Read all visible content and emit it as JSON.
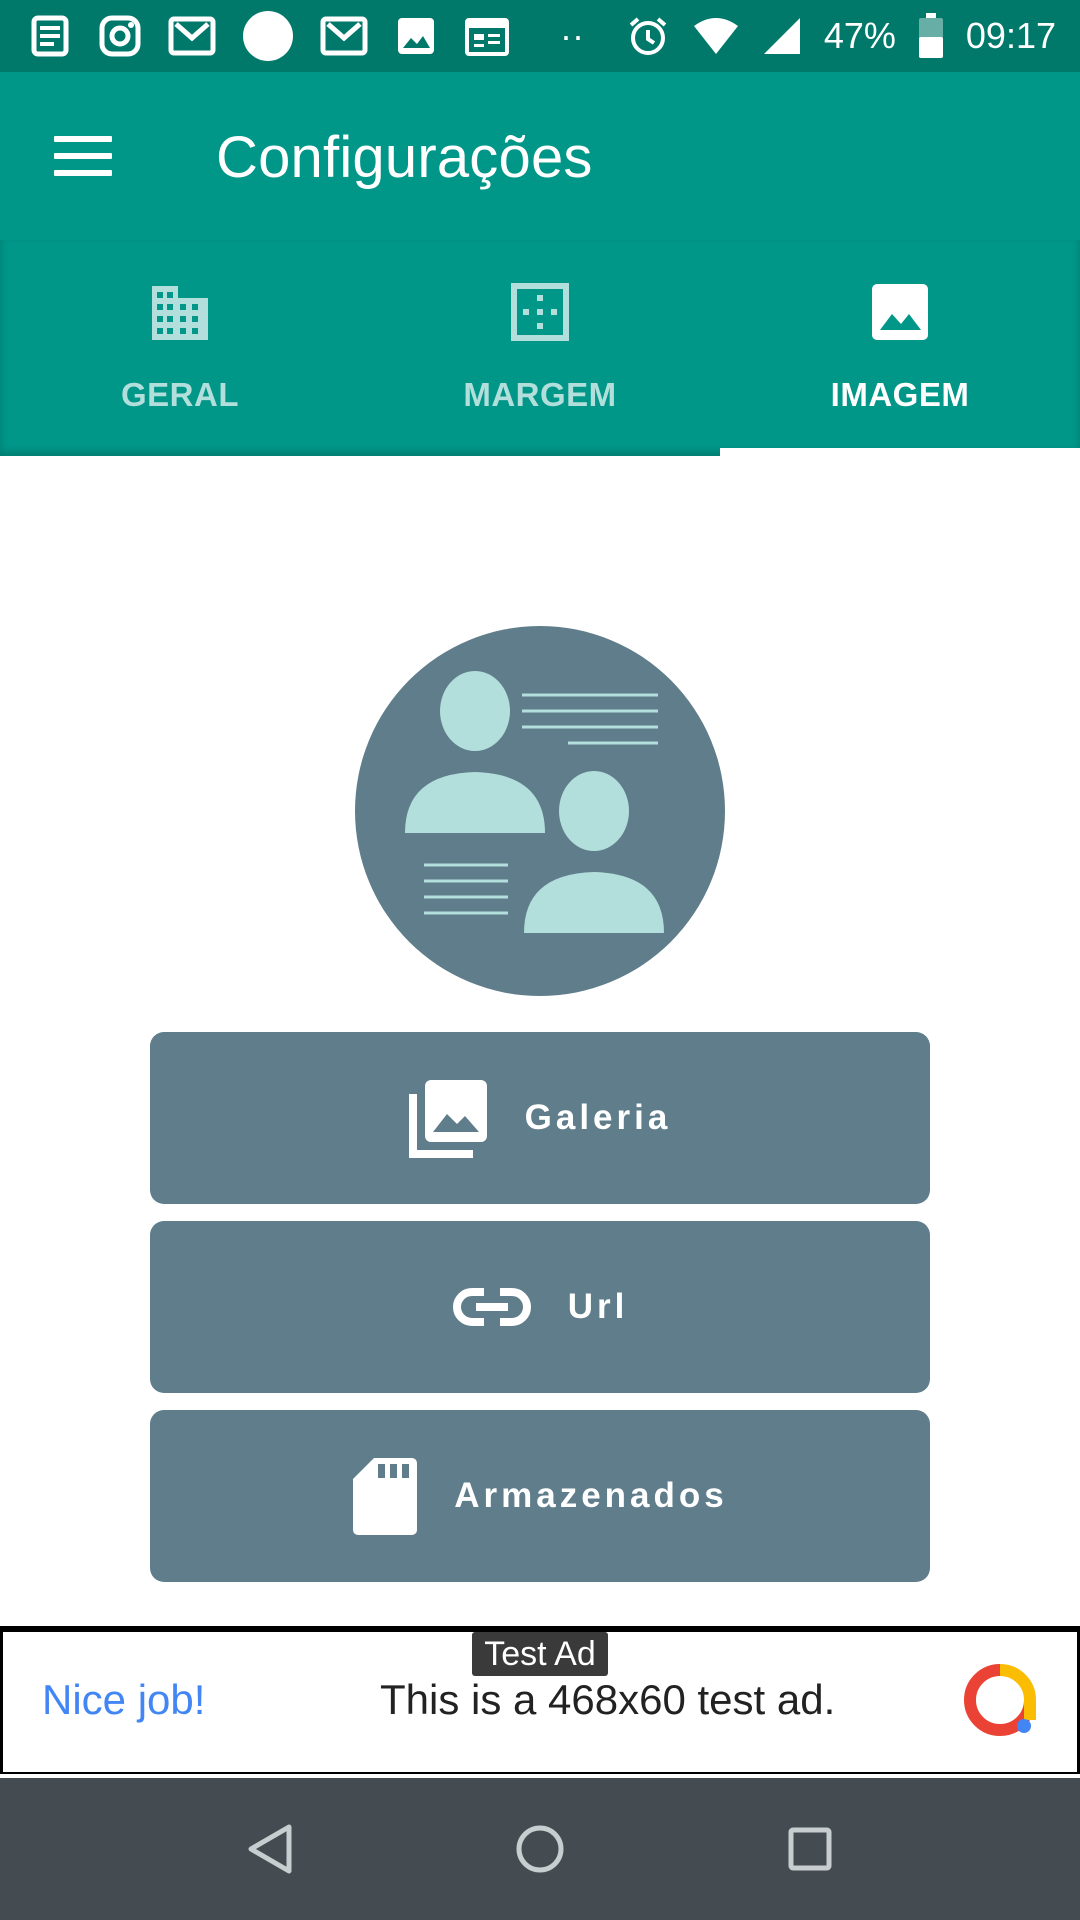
{
  "status_bar": {
    "battery": "47%",
    "time": "09:17",
    "overflow": "··"
  },
  "app_bar": {
    "title": "Configurações"
  },
  "tabs": [
    {
      "label": "GERAL",
      "icon": "building-icon",
      "selected": false
    },
    {
      "label": "MARGEM",
      "icon": "border-icon",
      "selected": false
    },
    {
      "label": "IMAGEM",
      "icon": "image-icon",
      "selected": true
    }
  ],
  "actions": [
    {
      "label": "Galeria",
      "icon": "photo-library-icon"
    },
    {
      "label": "Url",
      "icon": "link-icon"
    },
    {
      "label": "Armazenados",
      "icon": "sd-card-icon"
    }
  ],
  "ad": {
    "badge": "Test Ad",
    "nice": "Nice job!",
    "text": "This is a 468x60 test ad."
  },
  "colors": {
    "status_bar": "#00796b",
    "primary": "#009688",
    "button": "#607d8b",
    "avatar_bg": "#607d8b",
    "avatar_fg": "#b2dfdb",
    "nav_bar": "#444c52"
  }
}
